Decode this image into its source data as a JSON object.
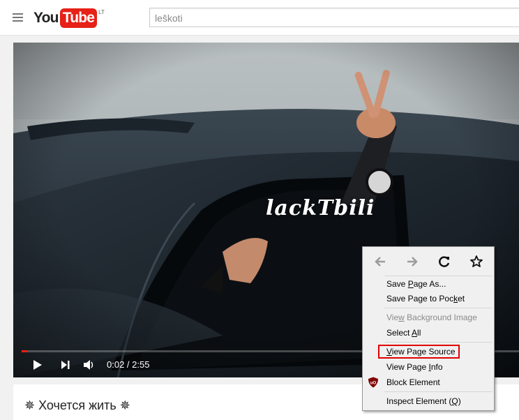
{
  "header": {
    "logo_you": "You",
    "logo_tube": "Tube",
    "region": "LT",
    "search_value": "leškoti"
  },
  "player": {
    "overlay_text": "lackTbili",
    "time_current": "0:02",
    "time_total": "2:55",
    "time_display": "0:02 / 2:55",
    "progress_fraction": 0.011
  },
  "video": {
    "title": "✵ Хочется жить ✵"
  },
  "context_menu": {
    "nav": [
      "back-icon",
      "forward-icon",
      "reload-icon",
      "bookmark-star-icon"
    ],
    "items": [
      {
        "pre": "Save ",
        "key": "P",
        "post": "age As...",
        "disabled": false
      },
      {
        "pre": "Save Page to Poc",
        "key": "k",
        "post": "et",
        "disabled": false
      },
      {
        "pre": "Vie",
        "key": "w",
        "post": " Background Image",
        "disabled": true
      },
      {
        "pre": "Select ",
        "key": "A",
        "post": "ll",
        "disabled": false
      },
      {
        "pre": "",
        "key": "V",
        "post": "iew Page Source",
        "disabled": false
      },
      {
        "pre": "View Page ",
        "key": "I",
        "post": "nfo",
        "disabled": false
      },
      {
        "pre": "Block Element",
        "key": "",
        "post": "",
        "disabled": false
      },
      {
        "pre": "Inspect Element (",
        "key": "Q",
        "post": ")",
        "disabled": false
      }
    ]
  },
  "colors": {
    "youtube_red": "#e62117",
    "highlight_red": "#e00000",
    "menu_bg": "#f0f0f0"
  }
}
